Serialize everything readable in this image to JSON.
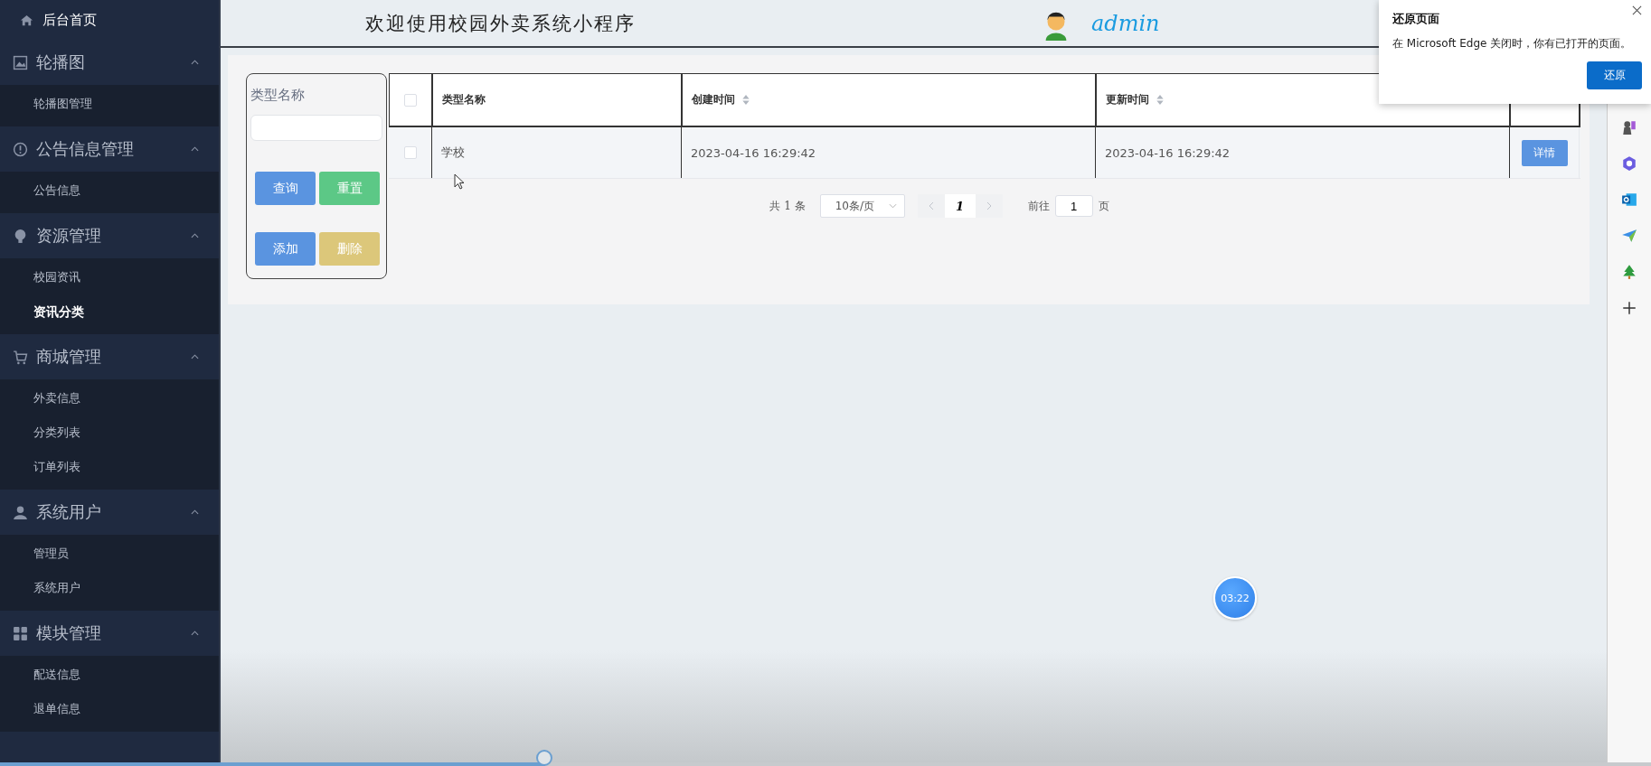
{
  "sidebar": {
    "home": {
      "label": "后台首页"
    },
    "groups": [
      {
        "label": "轮播图",
        "expanded": true,
        "children": [
          {
            "label": "轮播图管理",
            "selected": false
          }
        ]
      },
      {
        "label": "公告信息管理",
        "expanded": true,
        "children": [
          {
            "label": "公告信息",
            "selected": false
          }
        ]
      },
      {
        "label": "资源管理",
        "expanded": true,
        "children": [
          {
            "label": "校园资讯",
            "selected": false
          },
          {
            "label": "资讯分类",
            "selected": true
          }
        ]
      },
      {
        "label": "商城管理",
        "expanded": true,
        "children": [
          {
            "label": "外卖信息",
            "selected": false
          },
          {
            "label": "分类列表",
            "selected": false
          },
          {
            "label": "订单列表",
            "selected": false
          }
        ]
      },
      {
        "label": "系统用户",
        "expanded": true,
        "children": [
          {
            "label": "管理员",
            "selected": false
          },
          {
            "label": "系统用户",
            "selected": false
          }
        ]
      },
      {
        "label": "模块管理",
        "expanded": true,
        "children": [
          {
            "label": "配送信息",
            "selected": false
          },
          {
            "label": "退单信息",
            "selected": false
          }
        ]
      }
    ]
  },
  "header": {
    "title": "欢迎使用校园外卖系统小程序",
    "user": "admin"
  },
  "filter": {
    "label": "类型名称",
    "buttons": [
      {
        "label": "查询",
        "kind": "primary"
      },
      {
        "label": "重置",
        "kind": "success"
      },
      {
        "label": "添加",
        "kind": "primary"
      },
      {
        "label": "删除",
        "kind": "warning"
      }
    ]
  },
  "table": {
    "header_checked": false,
    "columns": [
      {
        "label": "类型名称",
        "sortable": false
      },
      {
        "label": "创建时间",
        "sortable": true
      },
      {
        "label": "更新时间",
        "sortable": true
      }
    ],
    "rows": [
      {
        "checked": false,
        "cells": [
          "学校",
          "2023-04-16 16:29:42",
          "2023-04-16 16:29:42"
        ],
        "action": "详情"
      }
    ]
  },
  "pagination": {
    "total": "共 1 条",
    "page_size": "10条/页",
    "current": "1",
    "goto_label": "前往",
    "goto_value": "1",
    "page_unit": "页"
  },
  "popup": {
    "title": "还原页面",
    "message": "在 Microsoft Edge 关闭时，你有已打开的页面。",
    "button": "还原"
  },
  "timer": "03:22",
  "video_progress": {
    "level": 0.33
  }
}
